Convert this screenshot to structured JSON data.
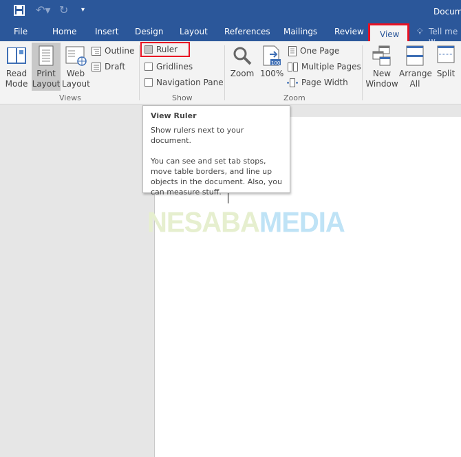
{
  "title": "Docum",
  "qat": {
    "save": "save-icon",
    "undo": "undo-icon",
    "redo": "redo-icon",
    "customize": "▾"
  },
  "tabs": [
    "File",
    "Home",
    "Insert",
    "Design",
    "Layout",
    "References",
    "Mailings",
    "Review",
    "View"
  ],
  "active_tab": "View",
  "tell_me": "Tell me w",
  "views": {
    "read_mode": [
      "Read",
      "Mode"
    ],
    "print_layout": [
      "Print",
      "Layout"
    ],
    "web_layout": [
      "Web",
      "Layout"
    ],
    "outline": "Outline",
    "draft": "Draft",
    "group": "Views"
  },
  "show": {
    "ruler": "Ruler",
    "gridlines": "Gridlines",
    "navigation_pane": "Navigation Pane",
    "group": "Show",
    "ruler_checked": false,
    "gridlines_checked": false,
    "navigation_checked": false
  },
  "zoom": {
    "zoom": "Zoom",
    "hundred": "100%",
    "badge": "100",
    "one_page": "One Page",
    "multiple_pages": "Multiple Pages",
    "page_width": "Page Width",
    "group": "Zoom"
  },
  "window": {
    "new_window": [
      "New",
      "Window"
    ],
    "arrange_all": [
      "Arrange",
      "All"
    ],
    "split": "Split"
  },
  "tooltip": {
    "title": "View Ruler",
    "line1": "Show rulers next to your document.",
    "line2": "You can see and set tab stops, move table borders, and line up objects in the document. Also, you can measure stuff."
  },
  "watermark": {
    "part1": "NESABA",
    "part2": "MEDIA"
  },
  "colors": {
    "brand": "#2b579a",
    "highlight": "#e81123"
  }
}
